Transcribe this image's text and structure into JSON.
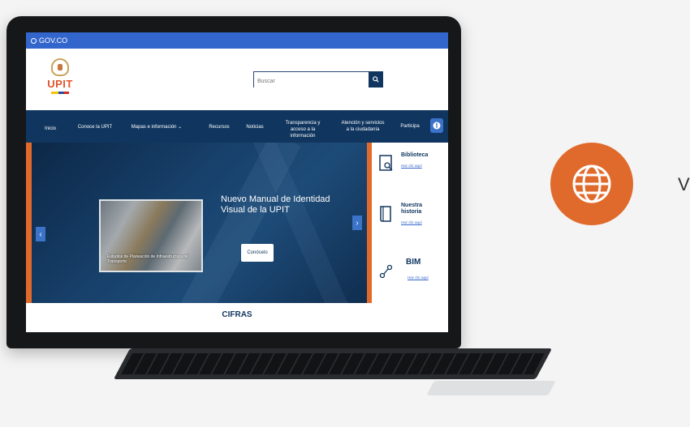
{
  "gov_bar": {
    "label": "GOV.CO"
  },
  "header": {
    "logo_text": "UPIT",
    "search_placeholder": "Buscar"
  },
  "nav": {
    "items": [
      {
        "label": "Inicio"
      },
      {
        "label": "Conoce la UPIT"
      },
      {
        "label": "Mapas e información"
      },
      {
        "label": "Recursos"
      },
      {
        "label": "Noticias"
      },
      {
        "label": "Transparencia y acceso a la información"
      },
      {
        "label": "Atención y servicios a la ciudadanía"
      },
      {
        "label": "Participa"
      }
    ]
  },
  "hero": {
    "slide_caption": "Estudios de Planeación de Infraestructura de Transporte",
    "title": "Nuevo Manual de Identidad Visual de la UPIT",
    "cta_label": "Conócelo"
  },
  "side_panel": {
    "items": [
      {
        "title": "Biblioteca",
        "link": "Haz clic aquí"
      },
      {
        "title": "Nuestra historia",
        "link": "Haz clic aquí"
      },
      {
        "title": "BIM",
        "link": "Haz clic aquí"
      }
    ]
  },
  "section": {
    "title": "CIFRAS"
  },
  "right_text": "V",
  "colors": {
    "gov_blue": "#3366cc",
    "navy": "#10365f",
    "accent_orange": "#e06a2c"
  }
}
